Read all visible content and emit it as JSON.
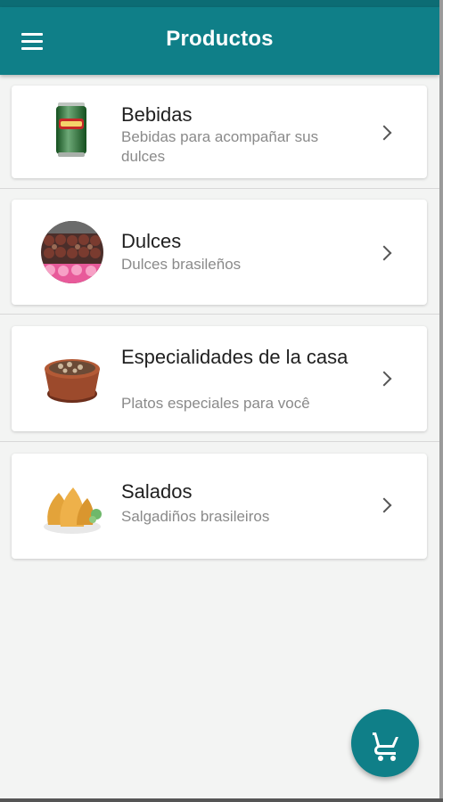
{
  "app_bar": {
    "title": "Productos",
    "menu_icon": "hamburger-menu-icon"
  },
  "categories": [
    {
      "title": "Bebidas",
      "subtitle": "Bebidas para acompañar sus dulces",
      "image": "soda-can-image"
    },
    {
      "title": "Dulces",
      "subtitle": "Dulces brasileños",
      "image": "brigadeiros-image"
    },
    {
      "title": "Especialidades de la casa",
      "subtitle": "Platos especiales para você",
      "image": "clay-pot-dish-image"
    },
    {
      "title": "Salados",
      "subtitle": "Salgadiños brasileiros",
      "image": "coxinhas-image"
    }
  ],
  "fab": {
    "icon": "shopping-cart-icon"
  },
  "colors": {
    "primary": "#0f7f88",
    "background": "#f3f4f3",
    "card": "#ffffff"
  }
}
